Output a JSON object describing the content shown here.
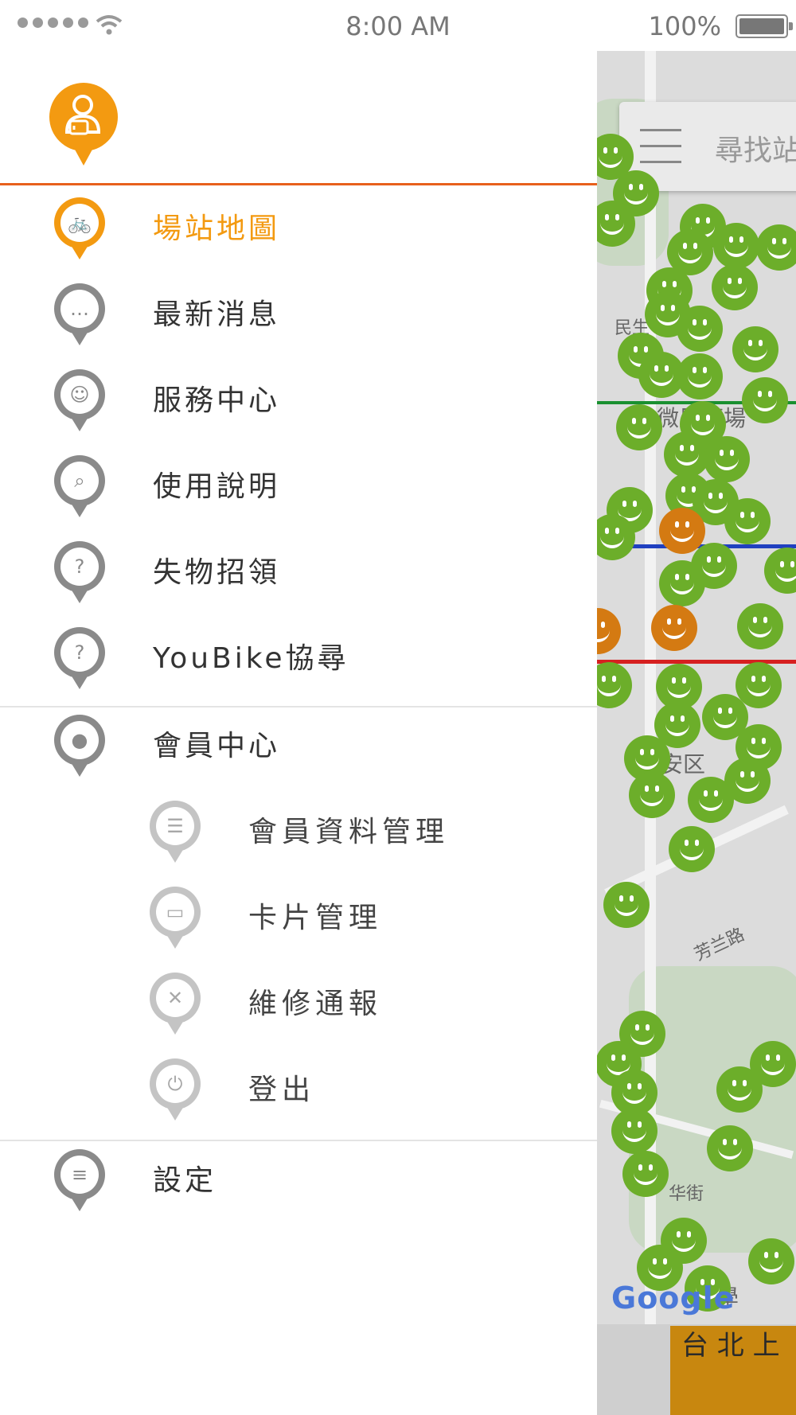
{
  "status_bar": {
    "time": "8:00 AM",
    "battery": "100%"
  },
  "colors": {
    "accent": "#f39a11",
    "divider_accent": "#e8601c",
    "icon_grey": "#8a8a8a",
    "station_green": "#6cae2a",
    "station_orange": "#d47a12"
  },
  "drawer": {
    "menu": [
      {
        "label": "場站地圖",
        "icon": "bike-icon",
        "active": true
      },
      {
        "label": "最新消息",
        "icon": "chat-bubble-icon",
        "active": false
      },
      {
        "label": "服務中心",
        "icon": "service-staff-icon",
        "active": false
      },
      {
        "label": "使用說明",
        "icon": "manual-search-icon",
        "active": false
      },
      {
        "label": "失物招領",
        "icon": "lost-luggage-icon",
        "active": false
      },
      {
        "label": "YouBike協尋",
        "icon": "bike-question-icon",
        "active": false
      }
    ],
    "member": {
      "label": "會員中心",
      "icon": "user-icon",
      "submenu": [
        {
          "label": "會員資料管理",
          "icon": "id-profile-icon"
        },
        {
          "label": "卡片管理",
          "icon": "card-icon"
        },
        {
          "label": "維修通報",
          "icon": "wrench-tools-icon"
        },
        {
          "label": "登出",
          "icon": "power-icon"
        }
      ]
    },
    "settings": {
      "label": "設定",
      "icon": "sliders-icon"
    }
  },
  "map": {
    "search_placeholder": "尋找站",
    "place_labels": [
      "民生",
      "微風廣場",
      "安区",
      "芳兰路",
      "华街",
      "學"
    ],
    "attribution": "Google"
  },
  "ad": {
    "text": "台 北 上"
  }
}
